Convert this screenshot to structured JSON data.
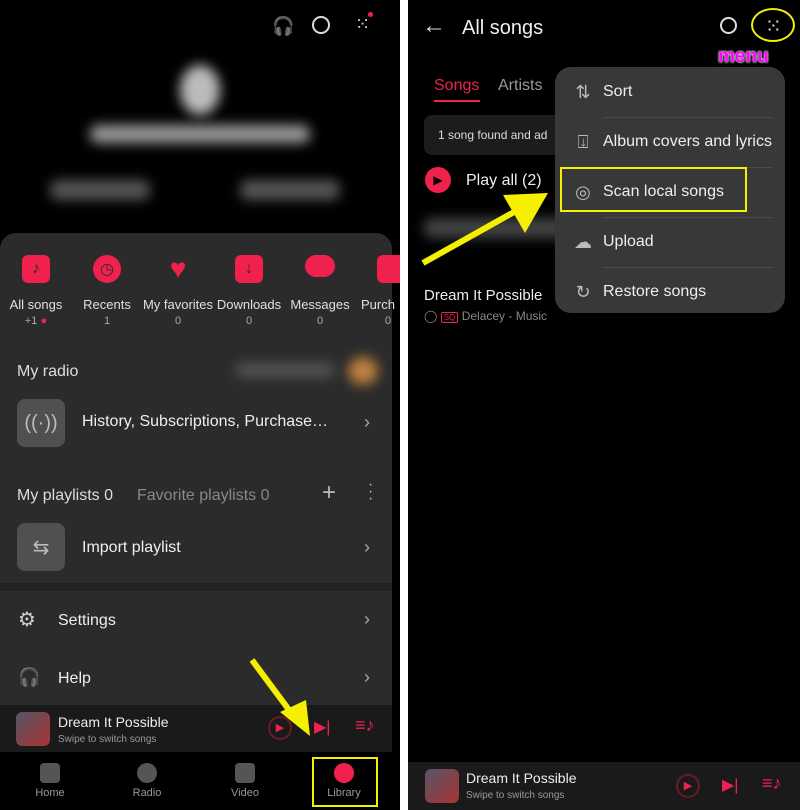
{
  "left": {
    "quick_items": [
      {
        "label": "All songs",
        "count": "+1",
        "icon": "music-note-icon"
      },
      {
        "label": "Recents",
        "count": "1",
        "icon": "clock-icon"
      },
      {
        "label": "My favorites",
        "count": "0",
        "icon": "heart-icon"
      },
      {
        "label": "Downloads",
        "count": "0",
        "icon": "download-icon"
      },
      {
        "label": "Messages",
        "count": "0",
        "icon": "message-icon"
      },
      {
        "label": "Purch",
        "count": "0",
        "icon": "purchase-icon"
      }
    ],
    "my_radio": "My radio",
    "radio_row": "History, Subscriptions, Purchase…",
    "my_playlists": "My playlists 0",
    "favorite_playlists": "Favorite playlists 0",
    "import_playlist": "Import playlist",
    "settings": "Settings",
    "help": "Help",
    "player": {
      "title": "Dream It Possible",
      "subtitle": "Swipe to switch songs"
    },
    "nav": [
      "Home",
      "Radio",
      "Video",
      "Library"
    ]
  },
  "right": {
    "title": "All songs",
    "tabs": [
      "Songs",
      "Artists"
    ],
    "notice": "1 song found and ad",
    "play_all": "Play all (2)",
    "song": {
      "title": "Dream It Possible",
      "badge": "SQ",
      "artist": "Delacey - Music"
    },
    "menu_items": [
      {
        "label": "Sort",
        "icon": "sort-icon"
      },
      {
        "label": "Album covers and lyrics",
        "icon": "download-box-icon"
      },
      {
        "label": "Scan local songs",
        "icon": "disc-scan-icon"
      },
      {
        "label": "Upload",
        "icon": "cloud-upload-icon"
      },
      {
        "label": "Restore songs",
        "icon": "restore-icon"
      }
    ],
    "player": {
      "title": "Dream It Possible",
      "subtitle": "Swipe to switch songs"
    }
  },
  "annotation": {
    "menu_label": "menu",
    "color": "#f4f000",
    "label_color": "#ff00ff"
  },
  "accent": "#f0224d"
}
